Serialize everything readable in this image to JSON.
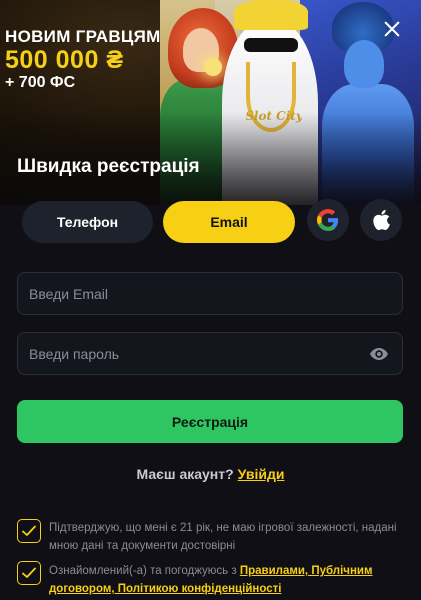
{
  "banner": {
    "promo_headline": "НОВИМ ГРАВЦЯМ",
    "promo_amount": "500 000 ₴",
    "promo_free_spins": "+ 700 ФС",
    "logo_text": "Slot City",
    "title": "Швидка реєстрація"
  },
  "tabs": [
    {
      "label": "Телефон",
      "active": false
    },
    {
      "label": "Email",
      "active": true
    }
  ],
  "social": [
    {
      "icon": "google-icon"
    },
    {
      "icon": "apple-icon"
    }
  ],
  "form": {
    "email_placeholder": "Введи Email",
    "email_value": "",
    "password_placeholder": "Введи пароль",
    "password_value": "",
    "register_label": "Реєстрація"
  },
  "login": {
    "prompt": "Маєш акаунт?",
    "link": "Увійди"
  },
  "consents": [
    {
      "checked": true,
      "text": "Підтверджую, що мені є 21 рік, не маю ігрової залежності, надані мною дані та документи достовірні"
    },
    {
      "checked": true,
      "text_before": "Ознайомлений(-а) та погоджуюсь з ",
      "link": "Правилами, Публічним договором, Політикою конфіденційності"
    }
  ],
  "colors": {
    "accent_yellow": "#f7cf15",
    "register_green": "#2ec662",
    "background": "#0f0f15"
  }
}
